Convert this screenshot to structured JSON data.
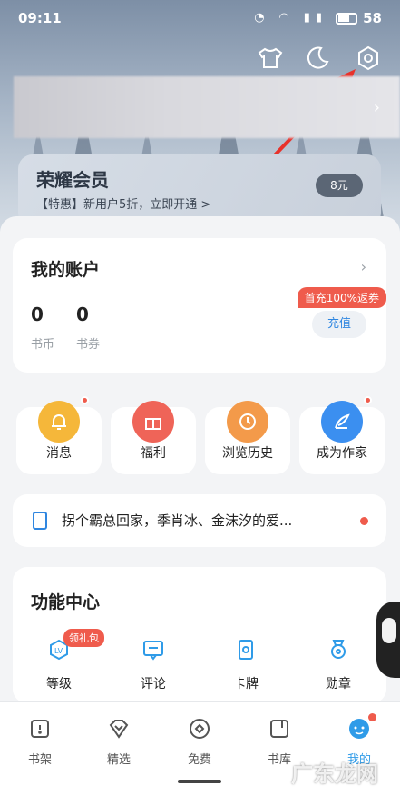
{
  "status_bar": {
    "time": "09:11",
    "battery": "58"
  },
  "vip": {
    "title": "荣耀会员",
    "subtitle": "【特惠】新用户5折，立即开通 >",
    "price_badge": "8元"
  },
  "account": {
    "title": "我的账户",
    "stats": [
      {
        "value": "0",
        "label": "书币"
      },
      {
        "value": "0",
        "label": "书券"
      }
    ],
    "promo_tag": "首充100%返券",
    "recharge_label": "充值"
  },
  "quick_actions": [
    {
      "label": "消息",
      "icon": "bell-icon",
      "color": "#f5b73a",
      "has_dot": true
    },
    {
      "label": "福利",
      "icon": "gift-icon",
      "color": "#ef6458",
      "has_dot": false
    },
    {
      "label": "浏览历史",
      "icon": "clock-icon",
      "color": "#f39a4a",
      "has_dot": false
    },
    {
      "label": "成为作家",
      "icon": "quill-icon",
      "color": "#3b8ff0",
      "has_dot": true
    }
  ],
  "notice": {
    "text": "拐个霸总回家，季肖冰、金沫汐的爱..."
  },
  "functions": {
    "title": "功能中心",
    "badge": "领礼包",
    "items": [
      {
        "label": "等级",
        "icon": "level-icon"
      },
      {
        "label": "评论",
        "icon": "comment-icon"
      },
      {
        "label": "卡牌",
        "icon": "card-icon"
      },
      {
        "label": "勋章",
        "icon": "medal-icon"
      }
    ]
  },
  "tabs": [
    {
      "label": "书架",
      "icon": "bookshelf-icon"
    },
    {
      "label": "精选",
      "icon": "diamond-icon"
    },
    {
      "label": "免费",
      "icon": "coin-icon"
    },
    {
      "label": "书库",
      "icon": "library-icon"
    },
    {
      "label": "我的",
      "icon": "profile-icon"
    }
  ],
  "watermark": "广东龙网",
  "colors": {
    "accent": "#2f9be8",
    "red": "#ef5b4c",
    "arrow": "#e8322b"
  }
}
